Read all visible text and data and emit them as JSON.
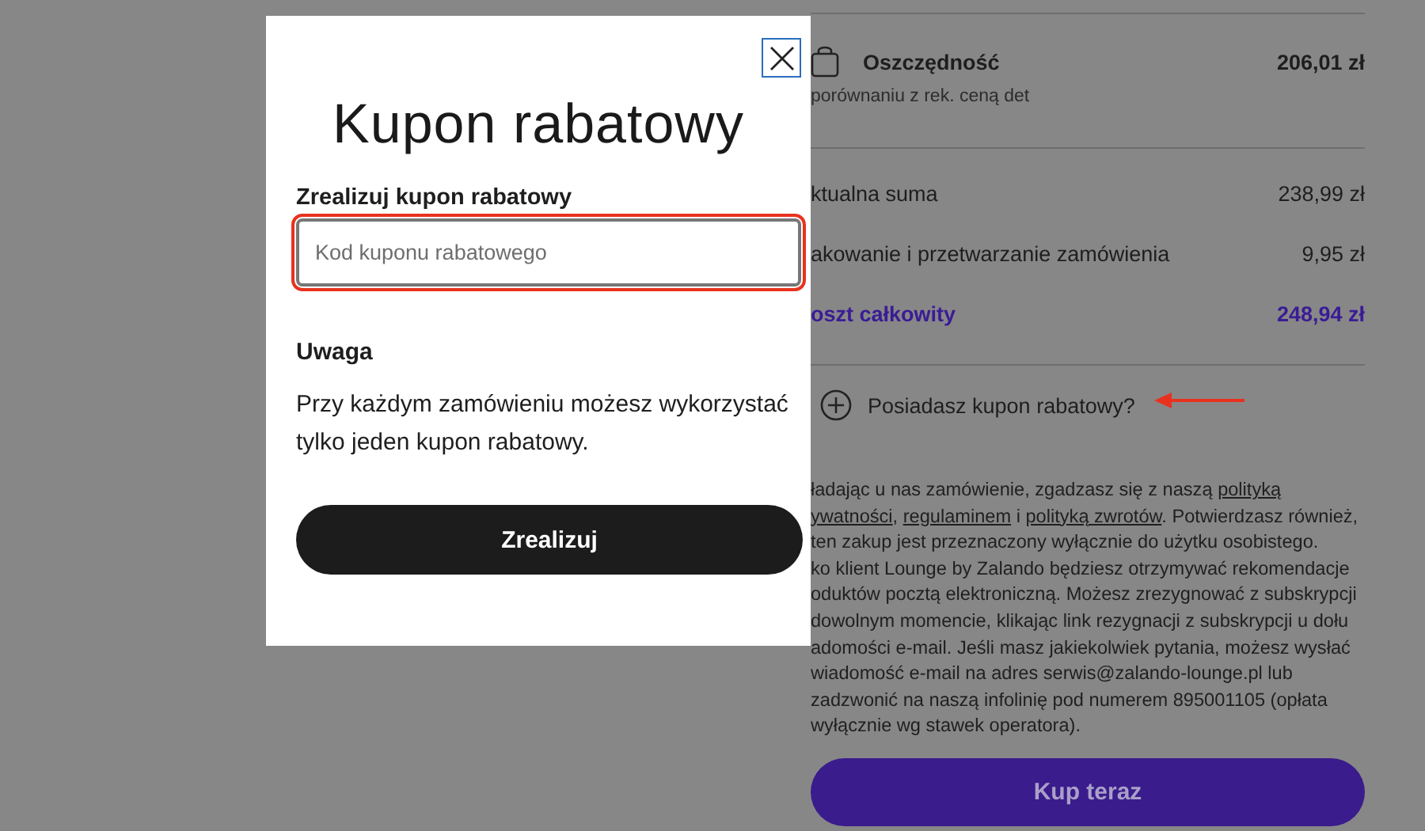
{
  "summary": {
    "savings": {
      "label": "Oszczędność",
      "amount": "206,01 zł",
      "note": "porównaniu z rek. ceną det"
    },
    "rows": [
      {
        "label": "ktualna suma",
        "amount": "238,99 zł",
        "kind": "plain"
      },
      {
        "label": "akowanie i przetwarzanie zamówienia",
        "amount": "9,95 zł",
        "kind": "plain"
      },
      {
        "label": "oszt całkowity",
        "amount": "248,94 zł",
        "kind": "total"
      }
    ],
    "coupon_link": {
      "label": "Posiadasz kupon rabatowy?",
      "annotated": true
    },
    "legal_lines": [
      [
        {
          "text": "ładając u nas zamówienie, zgadzasz się z naszą ",
          "link": false
        },
        {
          "text": "polityką",
          "link": true
        }
      ],
      [
        {
          "text": "ywatności",
          "link": true
        },
        {
          "text": ", ",
          "link": false
        },
        {
          "text": "regulaminem",
          "link": true
        },
        {
          "text": " i ",
          "link": false
        },
        {
          "text": "polityką zwrotów",
          "link": true
        },
        {
          "text": ". Potwierdzasz również,",
          "link": false
        }
      ],
      [
        {
          "text": "ten zakup jest przeznaczony wyłącznie do użytku osobistego.",
          "link": false
        }
      ],
      [
        {
          "text": "ko klient Lounge by Zalando będziesz otrzymywać rekomendacje",
          "link": false
        }
      ],
      [
        {
          "text": "oduktów pocztą elektroniczną. Możesz zrezygnować z subskrypcji",
          "link": false
        }
      ],
      [
        {
          "text": "dowolnym momencie, klikając link rezygnacji z subskrypcji u dołu",
          "link": false
        }
      ],
      [
        {
          "text": "adomości e-mail. Jeśli masz jakiekolwiek pytania, możesz wysłać",
          "link": false
        }
      ],
      [
        {
          "text": "wiadomość e-mail na adres serwis@zalando-lounge.pl lub",
          "link": false
        }
      ],
      [
        {
          "text": "zadzwonić na naszą infolinię pod numerem 895001105 (opłata",
          "link": false
        }
      ],
      [
        {
          "text": "wyłącznie wg stawek operatora).",
          "link": false
        }
      ]
    ],
    "buy_button": "Kup teraz"
  },
  "modal": {
    "title": "Kupon rabatowy",
    "field_label": "Zrealizuj kupon rabatowy",
    "field": {
      "placeholder": "Kod kuponu rabatowego",
      "annotated": true
    },
    "note_title": "Uwaga",
    "note": "Przy każdym zamówieniu możesz wykorzystać tylko jeden kupon rabatowy.",
    "submit": "Zrealizuj"
  }
}
